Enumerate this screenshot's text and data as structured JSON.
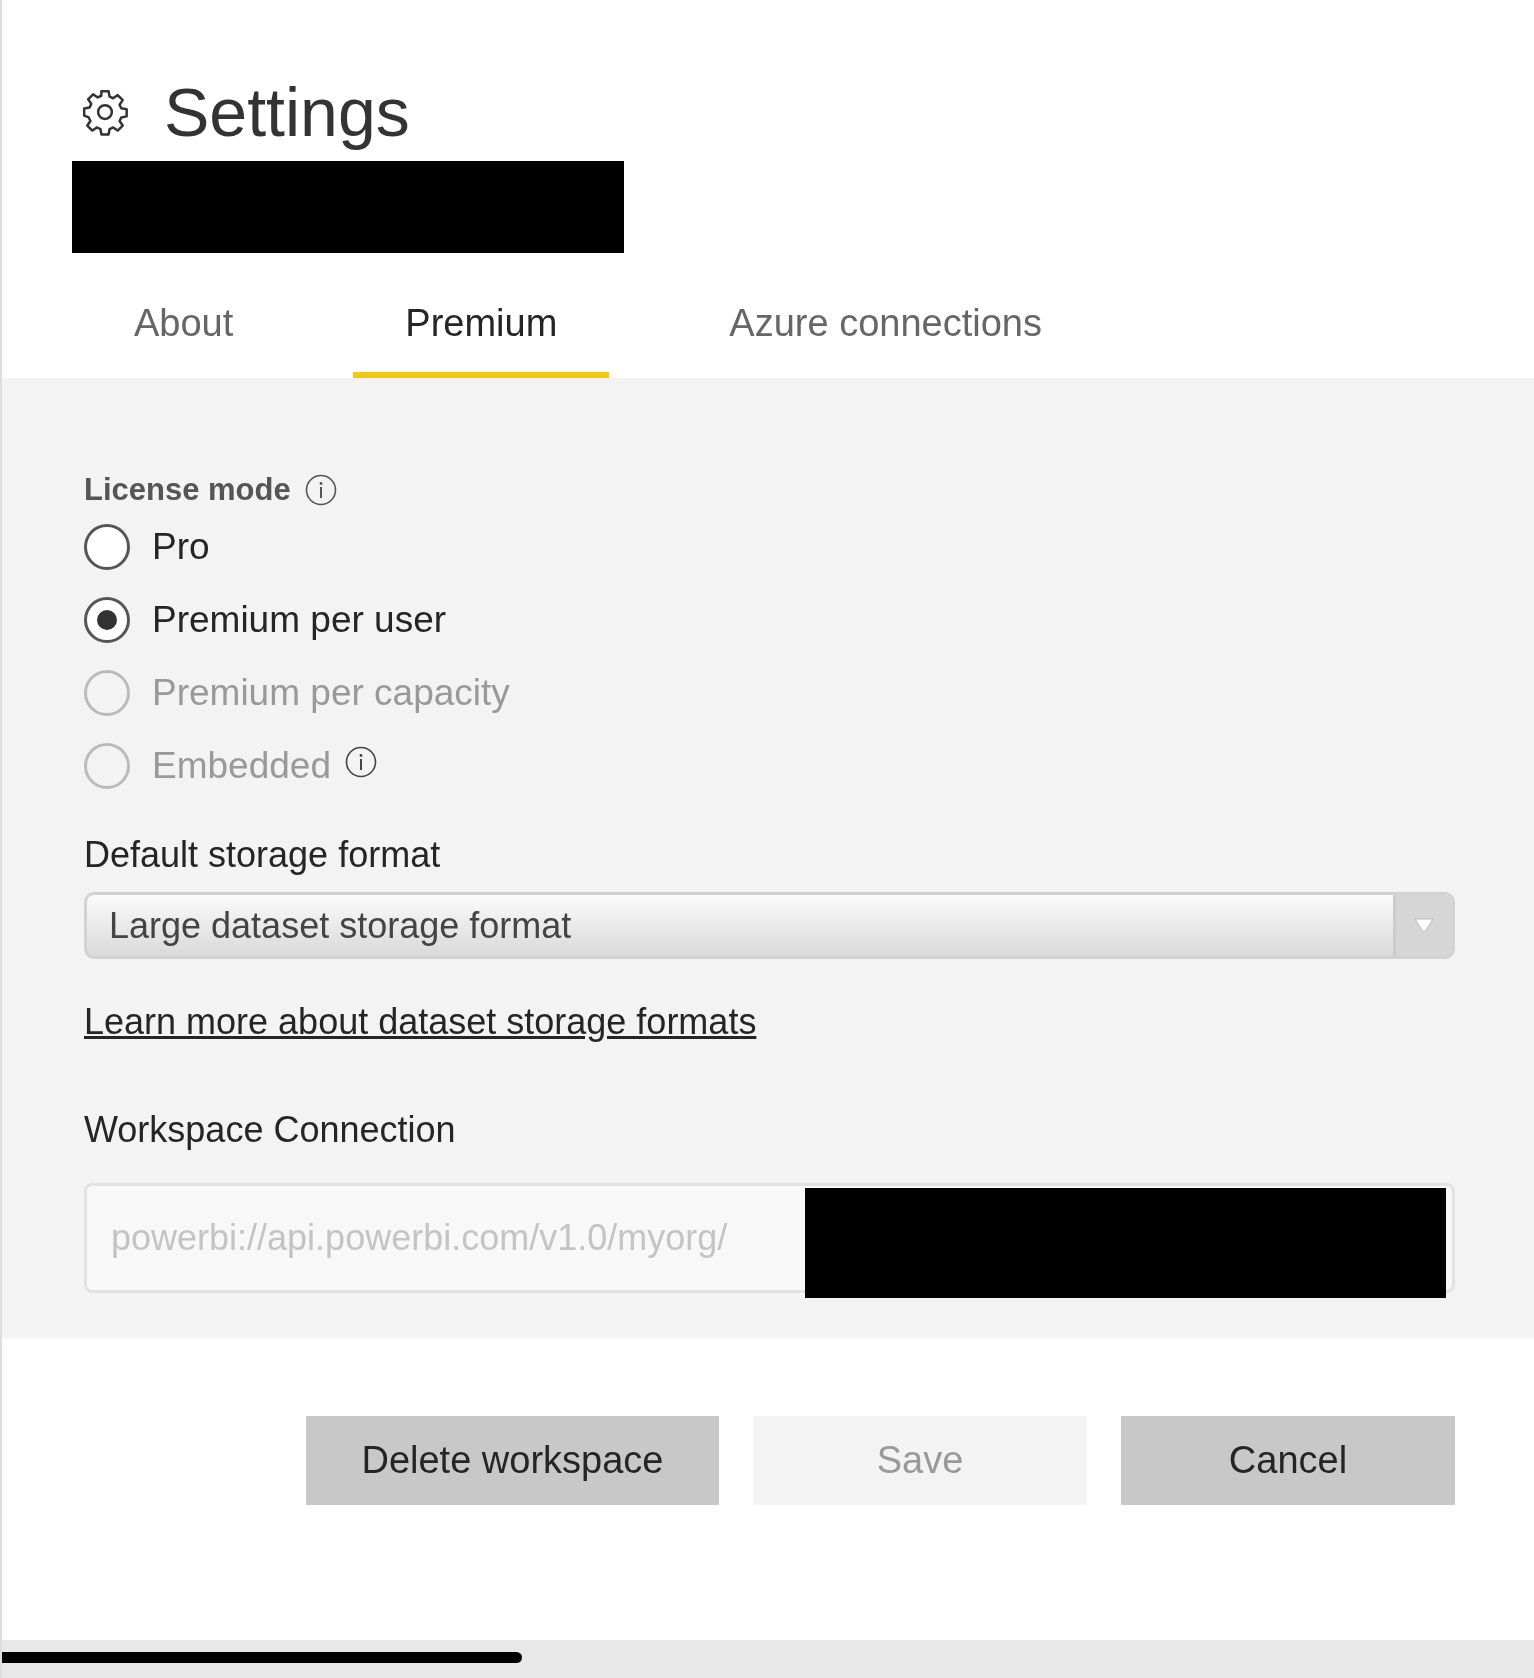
{
  "dialog": {
    "title": "Settings",
    "title_redacted": true
  },
  "tabs": [
    {
      "label": "About",
      "selected": false
    },
    {
      "label": "Premium",
      "selected": true
    },
    {
      "label": "Azure connections",
      "selected": false
    }
  ],
  "license_mode": {
    "label": "License mode",
    "info": true,
    "options": [
      {
        "label": "Pro",
        "selected": false,
        "disabled": false,
        "info": false
      },
      {
        "label": "Premium per user",
        "selected": true,
        "disabled": false,
        "info": false
      },
      {
        "label": "Premium per capacity",
        "selected": false,
        "disabled": true,
        "info": false
      },
      {
        "label": "Embedded",
        "selected": false,
        "disabled": true,
        "info": true
      }
    ]
  },
  "storage_format": {
    "label": "Default storage format",
    "value": "Large dataset storage format"
  },
  "learn_more_link": "Learn more about dataset storage formats",
  "workspace_connection": {
    "label": "Workspace Connection",
    "value": "powerbi://api.powerbi.com/v1.0/myorg/",
    "redacted": true
  },
  "buttons": [
    {
      "label": "Delete workspace",
      "disabled": false
    },
    {
      "label": "Save",
      "disabled": true
    },
    {
      "label": "Cancel",
      "disabled": false
    }
  ]
}
